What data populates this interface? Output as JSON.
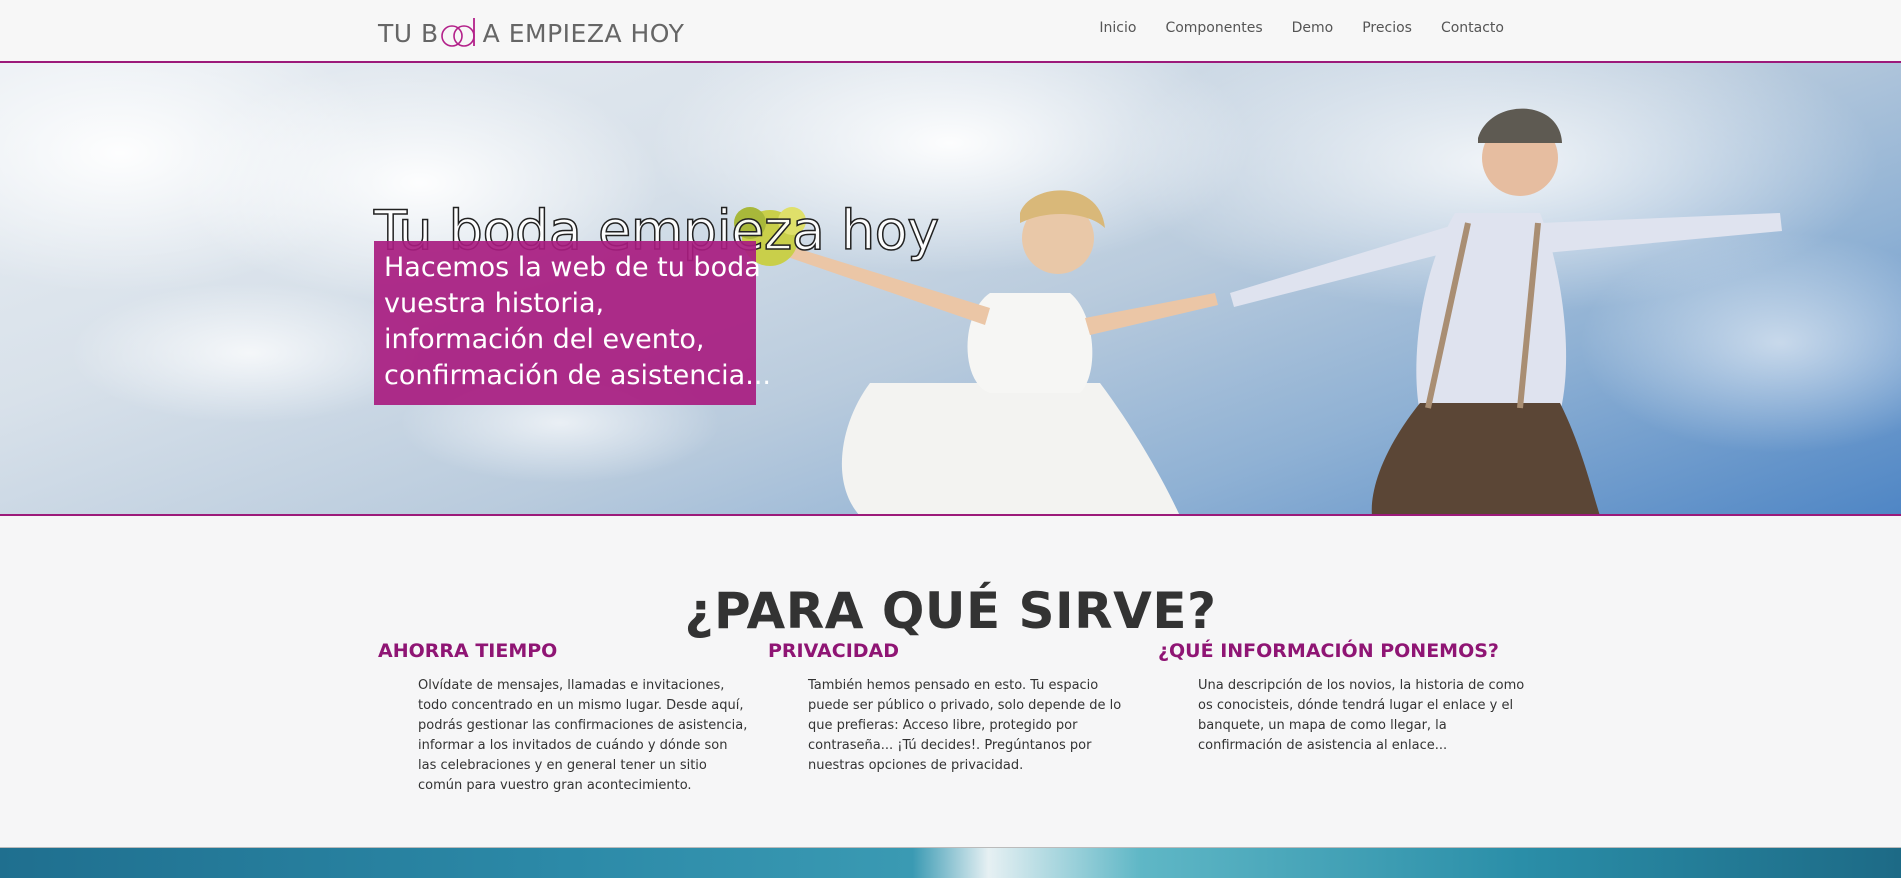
{
  "brand": {
    "text_left": "TU B",
    "text_right": "A EMPIEZA HOY",
    "logo_color": "#b3218a"
  },
  "nav": {
    "items": [
      "Inicio",
      "Componentes",
      "Demo",
      "Precios",
      "Contacto"
    ]
  },
  "hero": {
    "title": "Tu boda empieza hoy",
    "lines": [
      "Hacemos la web de tu boda",
      "vuestra historia,",
      "información del evento,",
      "confirmación de asistencia..."
    ],
    "box_color": "#a81c80"
  },
  "section": {
    "title": "¿PARA QUÉ SIRVE?",
    "features": [
      {
        "title": "AHORRA TIEMPO",
        "text": "Olvídate de mensajes, llamadas e invitaciones, todo concentrado en un mismo lugar. Desde aquí, podrás gestionar las confirmaciones de asistencia, informar a los invitados de cuándo y dónde son las celebraciones y en general tener un sitio común para vuestro gran acontecimiento."
      },
      {
        "title": "PRIVACIDAD",
        "text": "También hemos pensado en esto. Tu espacio puede ser público o privado, solo depende de lo que prefieras: Acceso libre, protegido por contraseña... ¡Tú decides!. Pregúntanos por nuestras opciones de privacidad."
      },
      {
        "title": "¿QUÉ INFORMACIÓN PONEMOS?",
        "text": "Una descripción de los novios, la historia de como os conocisteis, dónde tendrá lugar el enlace y el banquete, un mapa de como llegar, la confirmación de asistencia al enlace..."
      }
    ]
  },
  "colors": {
    "accent": "#9c1a7a",
    "heading": "#8f1574"
  }
}
